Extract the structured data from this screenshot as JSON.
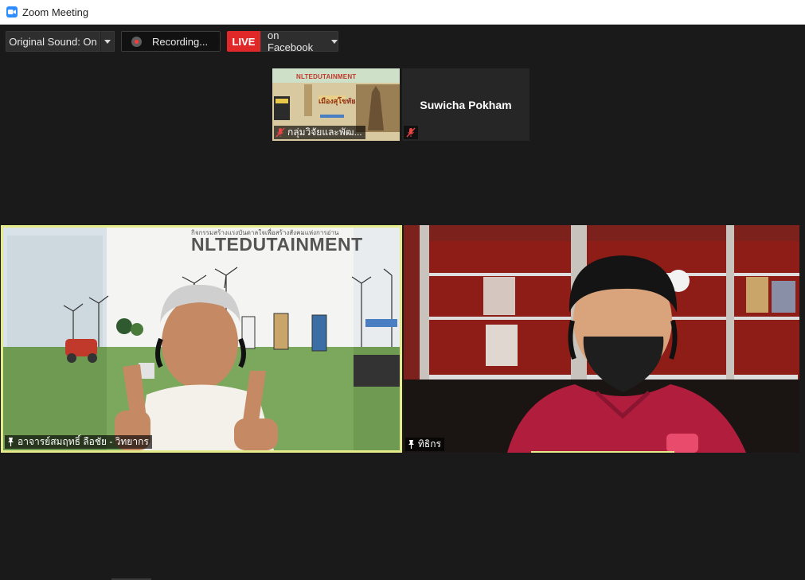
{
  "window": {
    "title": "Zoom Meeting"
  },
  "toolbar": {
    "original_sound_label": "Original Sound: On",
    "recording_label": "Recording...",
    "live_badge": "LIVE",
    "live_target": "on Facebook"
  },
  "thumbnails": [
    {
      "name": "กลุ่มวิจัยและพัฒ...",
      "muted": true,
      "video": true,
      "banner_title": "NLTEDUTAINMENT",
      "banner_subtitle": "เมืองสุโขทัย"
    },
    {
      "name": "Suwicha Pokham",
      "muted": true,
      "video": false
    }
  ],
  "main_tiles": [
    {
      "name": "อาจารย์สมฤทธิ์ ลือชัย - วิทยากร",
      "active_speaker": true,
      "banner_title": "NLTEDUTAINMENT",
      "banner_subtitle": "กิจกรรมสร้างแรงบันดาลใจเพื่อสร้างสังคมแห่งการอ่าน"
    },
    {
      "name": "ทิธิกร",
      "active_speaker": false
    }
  ],
  "colors": {
    "active_speaker_border": "#e5ea8a",
    "live_red": "#e02828",
    "zoom_blue": "#2d8cff"
  },
  "icons": [
    "zoom-logo-icon",
    "chevron-down-icon",
    "record-dot-icon",
    "mic-muted-icon",
    "pin-icon"
  ]
}
